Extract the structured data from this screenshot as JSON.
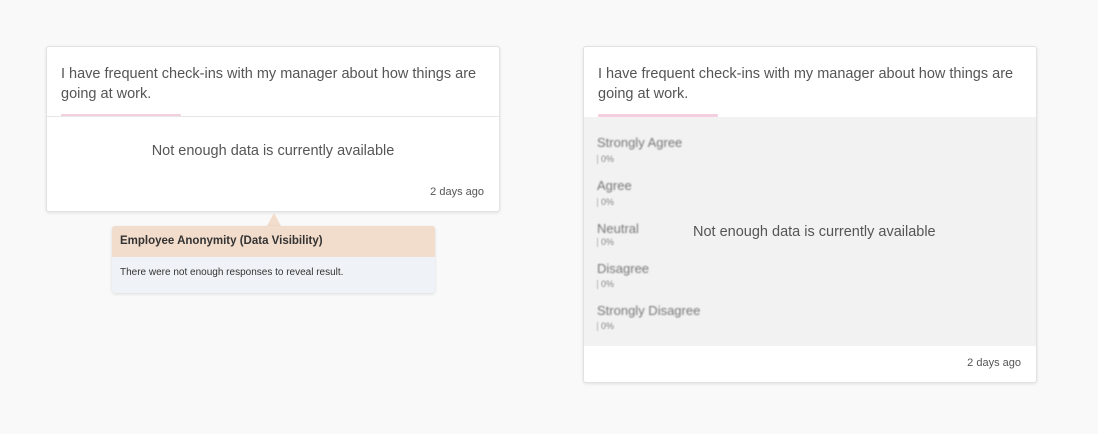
{
  "left_card": {
    "question": "I have frequent check-ins with my manager about how things are going at work.",
    "message": "Not enough data is currently available",
    "timestamp": "2 days ago"
  },
  "tooltip": {
    "title": "Employee Anonymity (Data Visibility)",
    "body": "There were not enough responses to reveal result."
  },
  "right_card": {
    "question": "I have frequent check-ins with my manager about how things are going at work.",
    "message": "Not enough data is currently available",
    "timestamp": "2 days ago",
    "options": [
      {
        "label": "Strongly Agree",
        "percent": "0%"
      },
      {
        "label": "Agree",
        "percent": "0%"
      },
      {
        "label": "Neutral",
        "percent": "0%"
      },
      {
        "label": "Disagree",
        "percent": "0%"
      },
      {
        "label": "Strongly Disagree",
        "percent": "0%"
      }
    ]
  },
  "colors": {
    "accent": "#f4cfe0",
    "tooltip_header": "#f2dccb",
    "tooltip_body": "#eff3f7",
    "blurred_area": "#f2f2f2"
  }
}
